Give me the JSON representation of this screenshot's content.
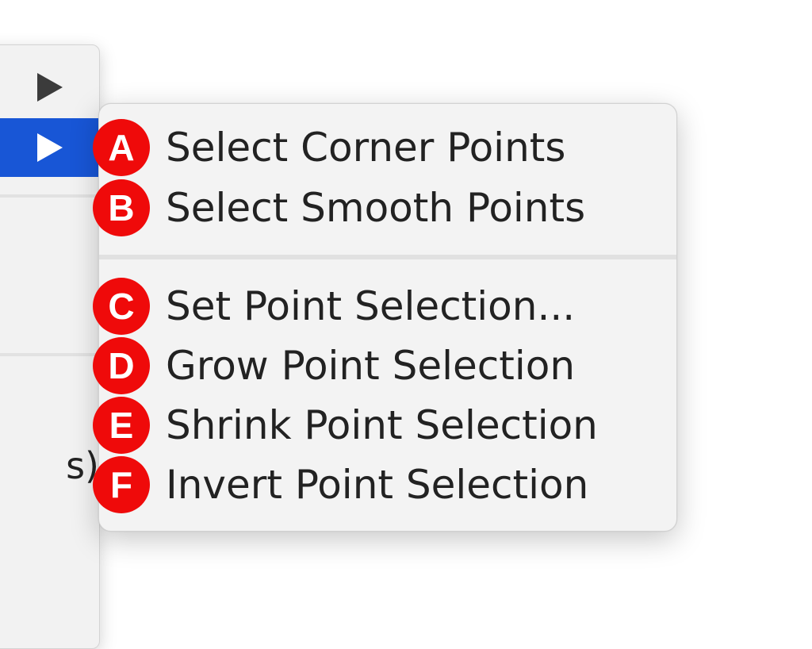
{
  "parent_menu": {
    "partial_text": "s)"
  },
  "submenu": {
    "items": [
      {
        "badge": "A",
        "label": "Select Corner Points"
      },
      {
        "badge": "B",
        "label": "Select Smooth Points"
      },
      {
        "badge": "C",
        "label": "Set Point Selection..."
      },
      {
        "badge": "D",
        "label": "Grow Point Selection"
      },
      {
        "badge": "E",
        "label": "Shrink Point Selection"
      },
      {
        "badge": "F",
        "label": "Invert Point Selection"
      }
    ]
  },
  "colors": {
    "highlight": "#1856d6",
    "badge": "#ef0a0a",
    "menu_bg": "#f3f3f3",
    "text": "#222222"
  },
  "icons": {
    "submenu_arrow": "triangle-right"
  }
}
